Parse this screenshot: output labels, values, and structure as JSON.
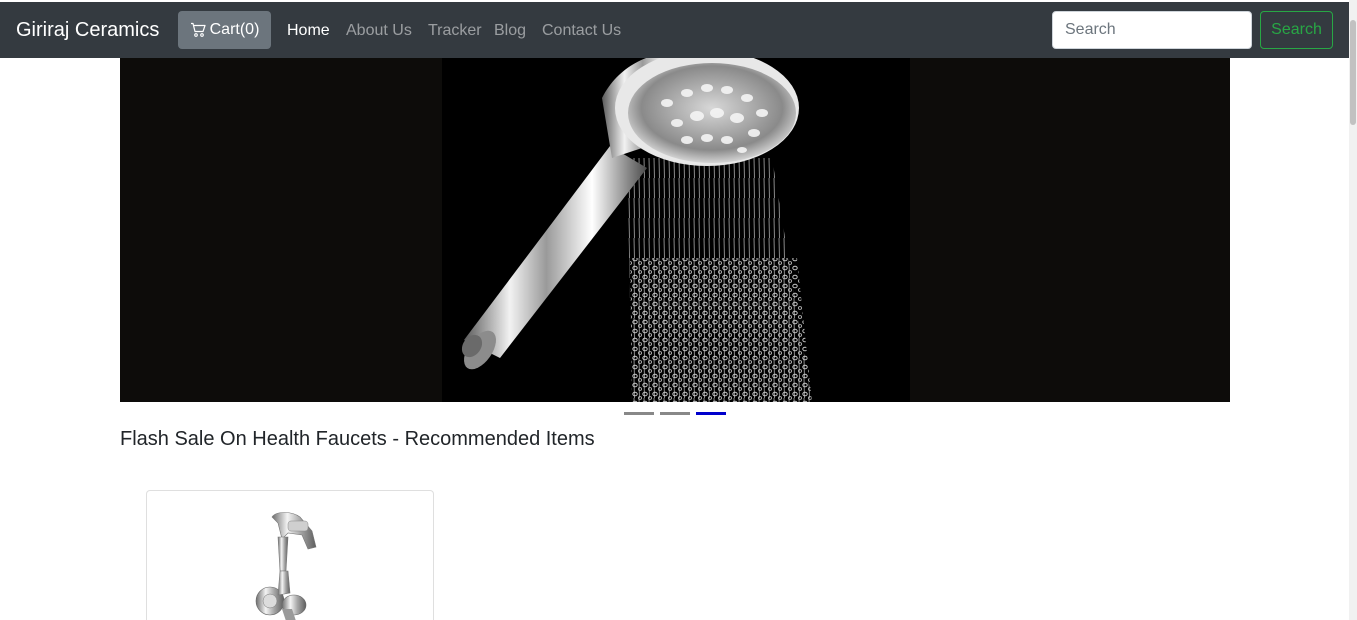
{
  "navbar": {
    "brand": "Giriraj Ceramics",
    "cart_label": "Cart(0)",
    "links": [
      {
        "label": "Home",
        "active": true
      },
      {
        "label": "About Us",
        "active": false
      },
      {
        "label": "Tracker",
        "active": false
      },
      {
        "label": "Blog",
        "active": false
      },
      {
        "label": "Contact Us",
        "active": false
      }
    ],
    "search_placeholder": "Search",
    "search_value": "",
    "search_button": "Search"
  },
  "carousel": {
    "slide_count": 3,
    "active_slide": 3
  },
  "section": {
    "title": "Flash Sale On Health Faucets - Recommended Items"
  },
  "colors": {
    "navbar_bg": "#343a40",
    "cart_button_bg": "#6c757d",
    "search_button_accent": "#28a745",
    "active_indicator": "#0000cc"
  },
  "icons": {
    "cart": "cart-icon"
  }
}
